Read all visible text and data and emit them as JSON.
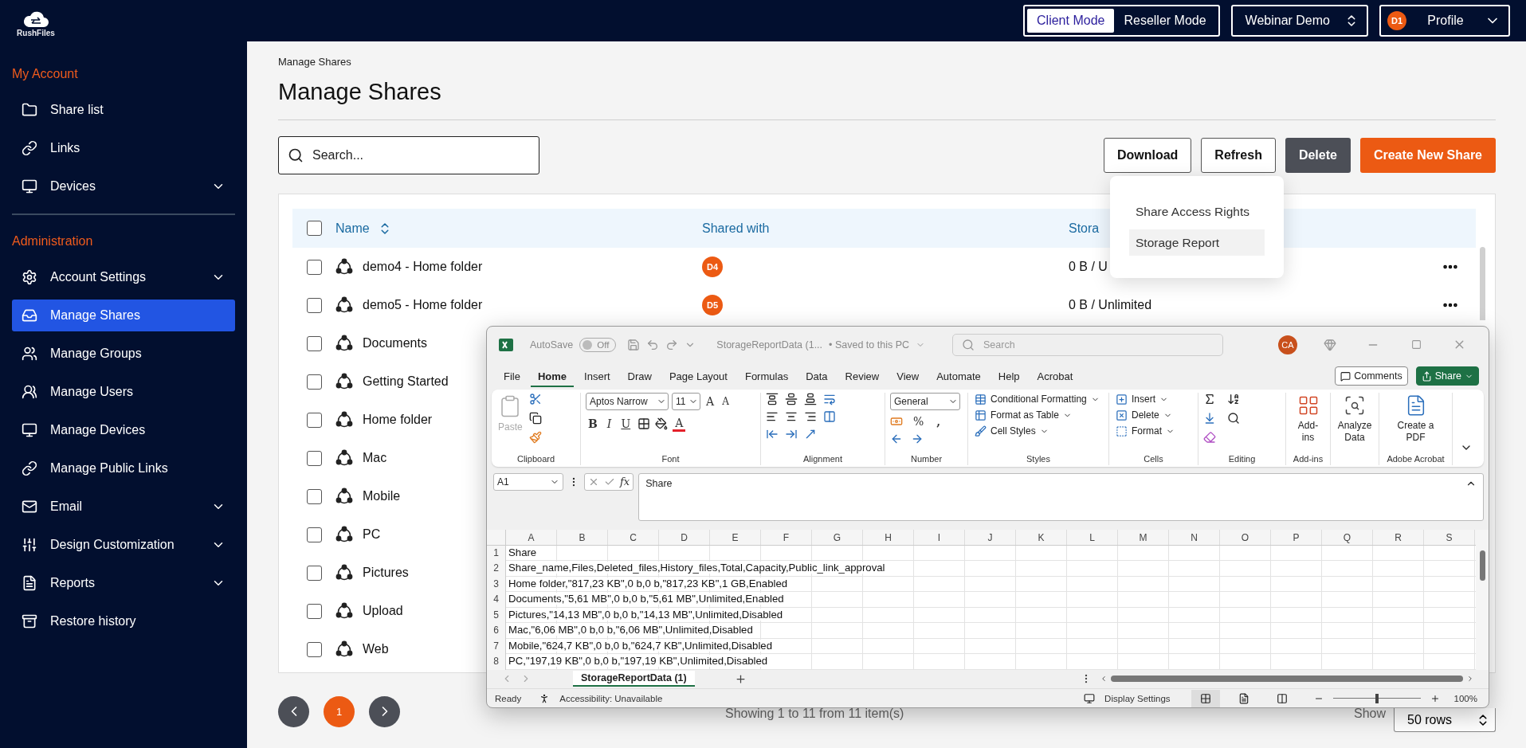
{
  "brand": {
    "name": "RushFiles"
  },
  "topbar": {
    "modes": [
      {
        "label": "Client Mode",
        "selected": true
      },
      {
        "label": "Reseller Mode",
        "selected": false
      }
    ],
    "workspace": "Webinar Demo",
    "profile": {
      "avatar": "D1",
      "label": "Profile"
    }
  },
  "sidebar": {
    "sections": [
      {
        "heading": "My Account",
        "items": [
          {
            "label": "Share list",
            "selected": false,
            "has_submenu": false
          },
          {
            "label": "Links",
            "selected": false,
            "has_submenu": false
          },
          {
            "label": "Devices",
            "selected": false,
            "has_submenu": true
          }
        ]
      },
      {
        "heading": "Administration",
        "items": [
          {
            "label": "Account Settings",
            "selected": false,
            "has_submenu": true
          },
          {
            "label": "Manage Shares",
            "selected": true,
            "has_submenu": false
          },
          {
            "label": "Manage Groups",
            "selected": false,
            "has_submenu": false
          },
          {
            "label": "Manage Users",
            "selected": false,
            "has_submenu": false
          },
          {
            "label": "Manage Devices",
            "selected": false,
            "has_submenu": false
          },
          {
            "label": "Manage Public Links",
            "selected": false,
            "has_submenu": false
          },
          {
            "label": "Email",
            "selected": false,
            "has_submenu": true
          },
          {
            "label": "Design Customization",
            "selected": false,
            "has_submenu": true
          },
          {
            "label": "Reports",
            "selected": false,
            "has_submenu": true
          },
          {
            "label": "Restore history",
            "selected": false,
            "has_submenu": false
          }
        ]
      }
    ]
  },
  "page": {
    "breadcrumb": "Manage Shares",
    "title": "Manage Shares",
    "search": {
      "placeholder": "Search..."
    },
    "actions": [
      {
        "label": "Download",
        "kind": "outline"
      },
      {
        "label": "Refresh",
        "kind": "outline"
      },
      {
        "label": "Delete",
        "kind": "dark"
      },
      {
        "label": "Create New Share",
        "kind": "primary"
      }
    ],
    "download_menu": [
      {
        "label": "Share Access Rights",
        "selected": false
      },
      {
        "label": "Storage Report",
        "selected": true
      }
    ]
  },
  "table": {
    "all_checked": false,
    "columns": [
      "Name",
      "Shared with",
      "Stora"
    ],
    "rows": [
      {
        "name": "demo4 - Home folder",
        "checked": false,
        "shared_with": "D4",
        "storage": "0 B / U",
        "menu": true
      },
      {
        "name": "demo5 - Home folder",
        "checked": false,
        "shared_with": "D5",
        "storage": "0 B / Unlimited",
        "menu": true
      },
      {
        "name": "Documents",
        "checked": false
      },
      {
        "name": "Getting Started",
        "checked": false
      },
      {
        "name": "Home folder",
        "checked": false
      },
      {
        "name": "Mac",
        "checked": false
      },
      {
        "name": "Mobile",
        "checked": false
      },
      {
        "name": "PC",
        "checked": false
      },
      {
        "name": "Pictures",
        "checked": false
      },
      {
        "name": "Upload",
        "checked": false
      },
      {
        "name": "Web",
        "checked": false
      }
    ]
  },
  "pagination": {
    "pages": [
      {
        "label": "1",
        "selected": true
      }
    ],
    "summary": "Showing 1 to 11 from 11 item(s)",
    "show_label": "Show",
    "page_size": "50 rows"
  },
  "excel": {
    "autosave_label": "AutoSave",
    "autosave": {
      "on": false,
      "label": "Off"
    },
    "document": "StorageReportData (1...",
    "save_status": "• Saved to this PC",
    "search_placeholder": "Search",
    "avatar": "CA",
    "tabs": [
      {
        "label": "File",
        "selected": false
      },
      {
        "label": "Home",
        "selected": true
      },
      {
        "label": "Insert",
        "selected": false
      },
      {
        "label": "Draw",
        "selected": false
      },
      {
        "label": "Page Layout",
        "selected": false
      },
      {
        "label": "Formulas",
        "selected": false
      },
      {
        "label": "Data",
        "selected": false
      },
      {
        "label": "Review",
        "selected": false
      },
      {
        "label": "View",
        "selected": false
      },
      {
        "label": "Automate",
        "selected": false
      },
      {
        "label": "Help",
        "selected": false
      },
      {
        "label": "Acrobat",
        "selected": false
      }
    ],
    "comments": "Comments",
    "share": "Share",
    "ribbon": [
      {
        "kind": "clipboard",
        "label": "Clipboard",
        "paste": "Paste"
      },
      {
        "kind": "font",
        "label": "Font",
        "font": "Aptos Narrow",
        "size": "11",
        "grow": "A",
        "shrink": "A",
        "bold": "B",
        "italic": "I",
        "underline": "U",
        "font_color": "A"
      },
      {
        "kind": "alignment",
        "label": "Alignment"
      },
      {
        "kind": "number",
        "label": "Number",
        "format": "General",
        "percent": "%",
        "comma": ","
      },
      {
        "kind": "list",
        "label": "Styles",
        "items": [
          "Conditional Formatting",
          "Format as Table",
          "Cell Styles"
        ]
      },
      {
        "kind": "list",
        "label": "Cells",
        "items": [
          "Insert",
          "Delete",
          "Format"
        ]
      },
      {
        "kind": "editing",
        "label": "Editing"
      },
      {
        "kind": "big",
        "label": "Add-ins",
        "button": "Add-ins"
      },
      {
        "kind": "big",
        "button": "Analyze Data"
      },
      {
        "kind": "big",
        "label": "Adobe Acrobat",
        "button": "Create a PDF"
      }
    ],
    "name_box": "A1",
    "fx": "fx",
    "formula": "Share",
    "columns": [
      "A",
      "B",
      "C",
      "D",
      "E",
      "F",
      "G",
      "H",
      "I",
      "J",
      "K",
      "L",
      "M",
      "N",
      "O",
      "P",
      "Q",
      "R",
      "S"
    ],
    "rows": [
      {
        "number": "1",
        "text": "Share"
      },
      {
        "number": "2",
        "text": "Share_name,Files,Deleted_files,History_files,Total,Capacity,Public_link_approval"
      },
      {
        "number": "3",
        "text": "Home folder,\"817,23 KB\",0 b,0 b,\"817,23 KB\",1 GB,Enabled"
      },
      {
        "number": "4",
        "text": "Documents,\"5,61 MB\",0 b,0 b,\"5,61 MB\",Unlimited,Enabled"
      },
      {
        "number": "5",
        "text": "Pictures,\"14,13 MB\",0 b,0 b,\"14,13 MB\",Unlimited,Disabled"
      },
      {
        "number": "6",
        "text": "Mac,\"6,06 MB\",0 b,0 b,\"6,06 MB\",Unlimited,Disabled"
      },
      {
        "number": "7",
        "text": "Mobile,\"624,7 KB\",0 b,0 b,\"624,7 KB\",Unlimited,Disabled"
      },
      {
        "number": "8",
        "text": "PC,\"197,19 KB\",0 b,0 b,\"197,19 KB\",Unlimited,Disabled"
      }
    ],
    "sheets": [
      {
        "label": "StorageReportData (1)",
        "selected": true
      }
    ],
    "status": {
      "ready": "Ready",
      "accessibility": "Accessibility: Unavailable",
      "display_settings": "Display Settings",
      "views": [
        {
          "kind": "normal",
          "selected": true
        },
        {
          "kind": "page_layout",
          "selected": false
        },
        {
          "kind": "page_break",
          "selected": false
        }
      ],
      "zoom": {
        "level": 0.5,
        "label": "100%"
      }
    }
  }
}
